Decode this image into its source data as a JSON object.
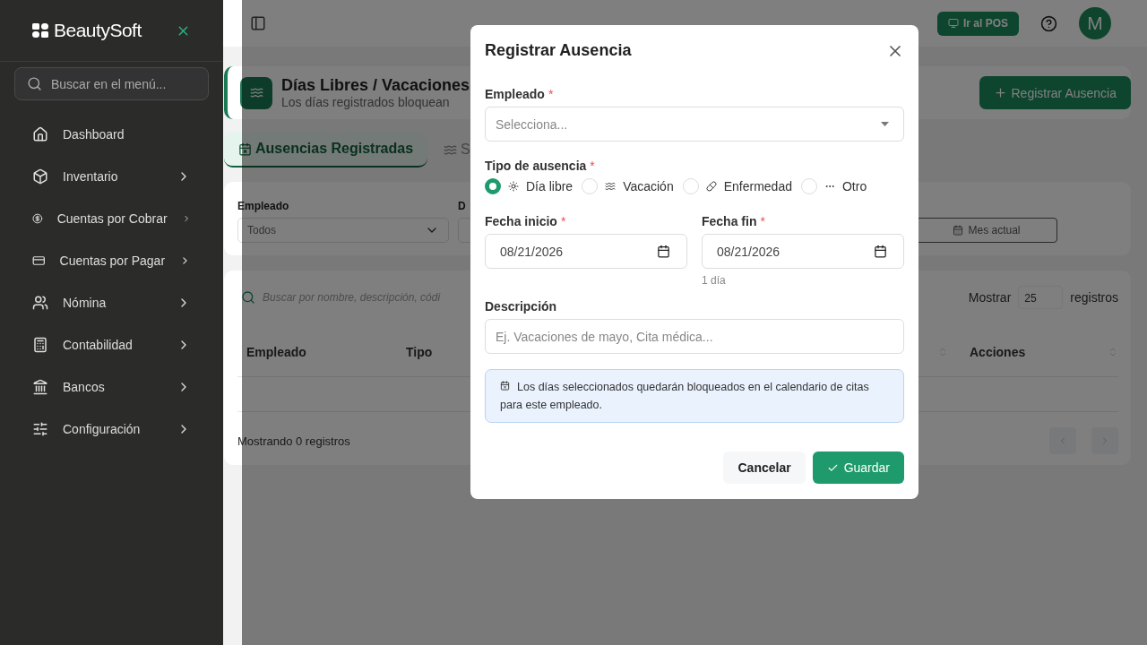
{
  "sidebar": {
    "brand": "BeautySoft",
    "search": {
      "placeholder": "Buscar en el menú..."
    },
    "items": [
      {
        "label": "Dashboard",
        "expandable": false
      },
      {
        "label": "Inventario",
        "expandable": true
      },
      {
        "label": "Cuentas por Cobrar",
        "expandable": true
      },
      {
        "label": "Cuentas por Pagar",
        "expandable": true
      },
      {
        "label": "Nómina",
        "expandable": true
      },
      {
        "label": "Contabilidad",
        "expandable": true
      },
      {
        "label": "Bancos",
        "expandable": true
      },
      {
        "label": "Configuración",
        "expandable": true
      }
    ]
  },
  "topbar": {
    "pos_button": "Ir al POS",
    "avatar": "M"
  },
  "page_header": {
    "title": "Días Libres / Vacaciones",
    "subtitle": "Los días registrados bloquean",
    "action": "Registrar Ausencia"
  },
  "tabs": [
    {
      "label": "Ausencias Registradas",
      "selected": true
    },
    {
      "label": "S",
      "selected": false
    }
  ],
  "filters": {
    "fields": [
      {
        "label": "Empleado",
        "value": "Todos"
      },
      {
        "label": "D"
      }
    ],
    "month_button": "Mes actual"
  },
  "table": {
    "search": {
      "placeholder": "Buscar por nombre, descripción, códi"
    },
    "show_label": "Mostrar",
    "page_size": "25",
    "records_label": "registros",
    "columns_left": [
      "Empleado",
      "Tipo"
    ],
    "columns_right": [
      "Acciones"
    ],
    "footer": "Mostrando 0 registros"
  },
  "modal": {
    "title": "Registrar Ausencia",
    "employee": {
      "label": "Empleado",
      "required_mark": "*",
      "placeholder": "Selecciona..."
    },
    "absence_type": {
      "label": "Tipo de ausencia",
      "required_mark": "*",
      "options": [
        {
          "label": "Día libre",
          "selected": true
        },
        {
          "label": "Vacación",
          "selected": false
        },
        {
          "label": "Enfermedad",
          "selected": false
        },
        {
          "label": "Otro",
          "selected": false
        }
      ]
    },
    "start": {
      "label": "Fecha inicio",
      "required_mark": "*",
      "value": "08/21/2026"
    },
    "end": {
      "label": "Fecha fin",
      "required_mark": "*",
      "value": "08/21/2026",
      "hint": "1 día"
    },
    "description": {
      "label": "Descripción",
      "placeholder": "Ej. Vacaciones de mayo, Cita médica..."
    },
    "info": "Los días seleccionados quedarán bloqueados en el calendario de citas para este empleado.",
    "cancel": "Cancelar",
    "save": "Guardar"
  }
}
